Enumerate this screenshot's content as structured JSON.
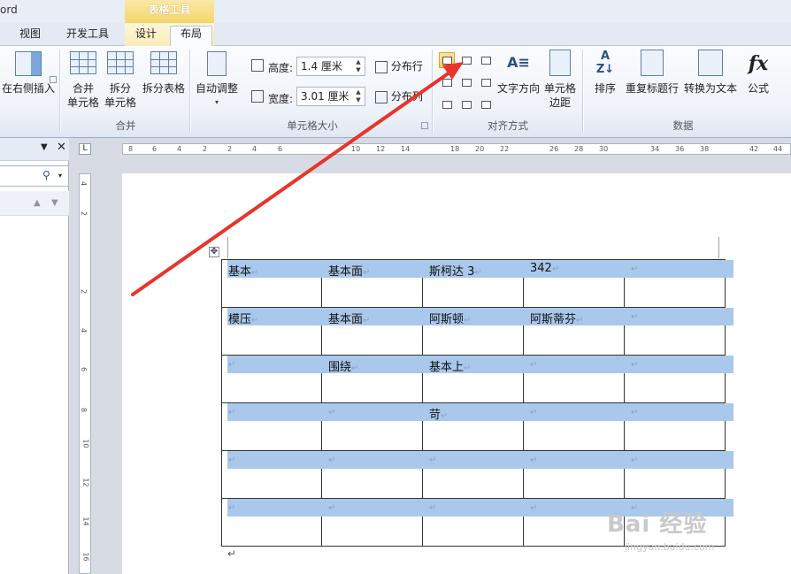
{
  "app_title": "ord",
  "context_group": "表格工具",
  "tabs": [
    {
      "label": "视图"
    },
    {
      "label": "开发工具"
    },
    {
      "label": "设计"
    },
    {
      "label": "布局"
    }
  ],
  "ribbon": {
    "insert_right": "在右侧插入",
    "merge_group": {
      "label": "合并",
      "merge_cells": [
        "合并",
        "单元格"
      ],
      "split_cells": [
        "拆分",
        "单元格"
      ],
      "split_table": "拆分表格"
    },
    "size_group": {
      "label": "单元格大小",
      "autofit": "自动调整",
      "height_label": "高度:",
      "height_value": "1.4 厘米",
      "width_label": "宽度:",
      "width_value": "3.01 厘米",
      "distribute_rows": "分布行",
      "distribute_cols": "分布列"
    },
    "align_group": {
      "label": "对齐方式",
      "text_direction": "文字方向",
      "cell_margins": [
        "单元格",
        "边距"
      ]
    },
    "data_group": {
      "label": "数据",
      "sort": "排序",
      "repeat_header": "重复标题行",
      "convert_text": "转换为文本",
      "formula": "公式"
    }
  },
  "ruler": {
    "h_ticks": [
      "8",
      "6",
      "4",
      "2",
      "2",
      "4",
      "6",
      "10",
      "12",
      "14",
      "18",
      "20",
      "22",
      "26",
      "28",
      "30",
      "34",
      "36",
      "38",
      "42",
      "44"
    ],
    "v_ticks": [
      "4",
      "2",
      "2",
      "4",
      "6",
      "8",
      "10",
      "12",
      "14",
      "16"
    ]
  },
  "table": {
    "rows": [
      [
        "基本",
        "基本面",
        "斯柯达 3",
        "342",
        ""
      ],
      [
        "模压",
        "基本面",
        "阿斯顿",
        "阿斯蒂芬",
        ""
      ],
      [
        "",
        "围绕",
        "基本上",
        "",
        ""
      ],
      [
        "",
        "",
        "苛",
        "",
        ""
      ],
      [
        "",
        "",
        "",
        "",
        ""
      ],
      [
        "",
        "",
        "",
        "",
        ""
      ]
    ],
    "cell_mark": "↵",
    "after_mark": "↵"
  },
  "watermark": {
    "brand": "Bai 经验",
    "url": "jingyan.baidu.com"
  },
  "colors": {
    "highlight": "#a9c8ec",
    "annotation_arrow": "#e8342a",
    "selected_align": "#f8c95a"
  }
}
